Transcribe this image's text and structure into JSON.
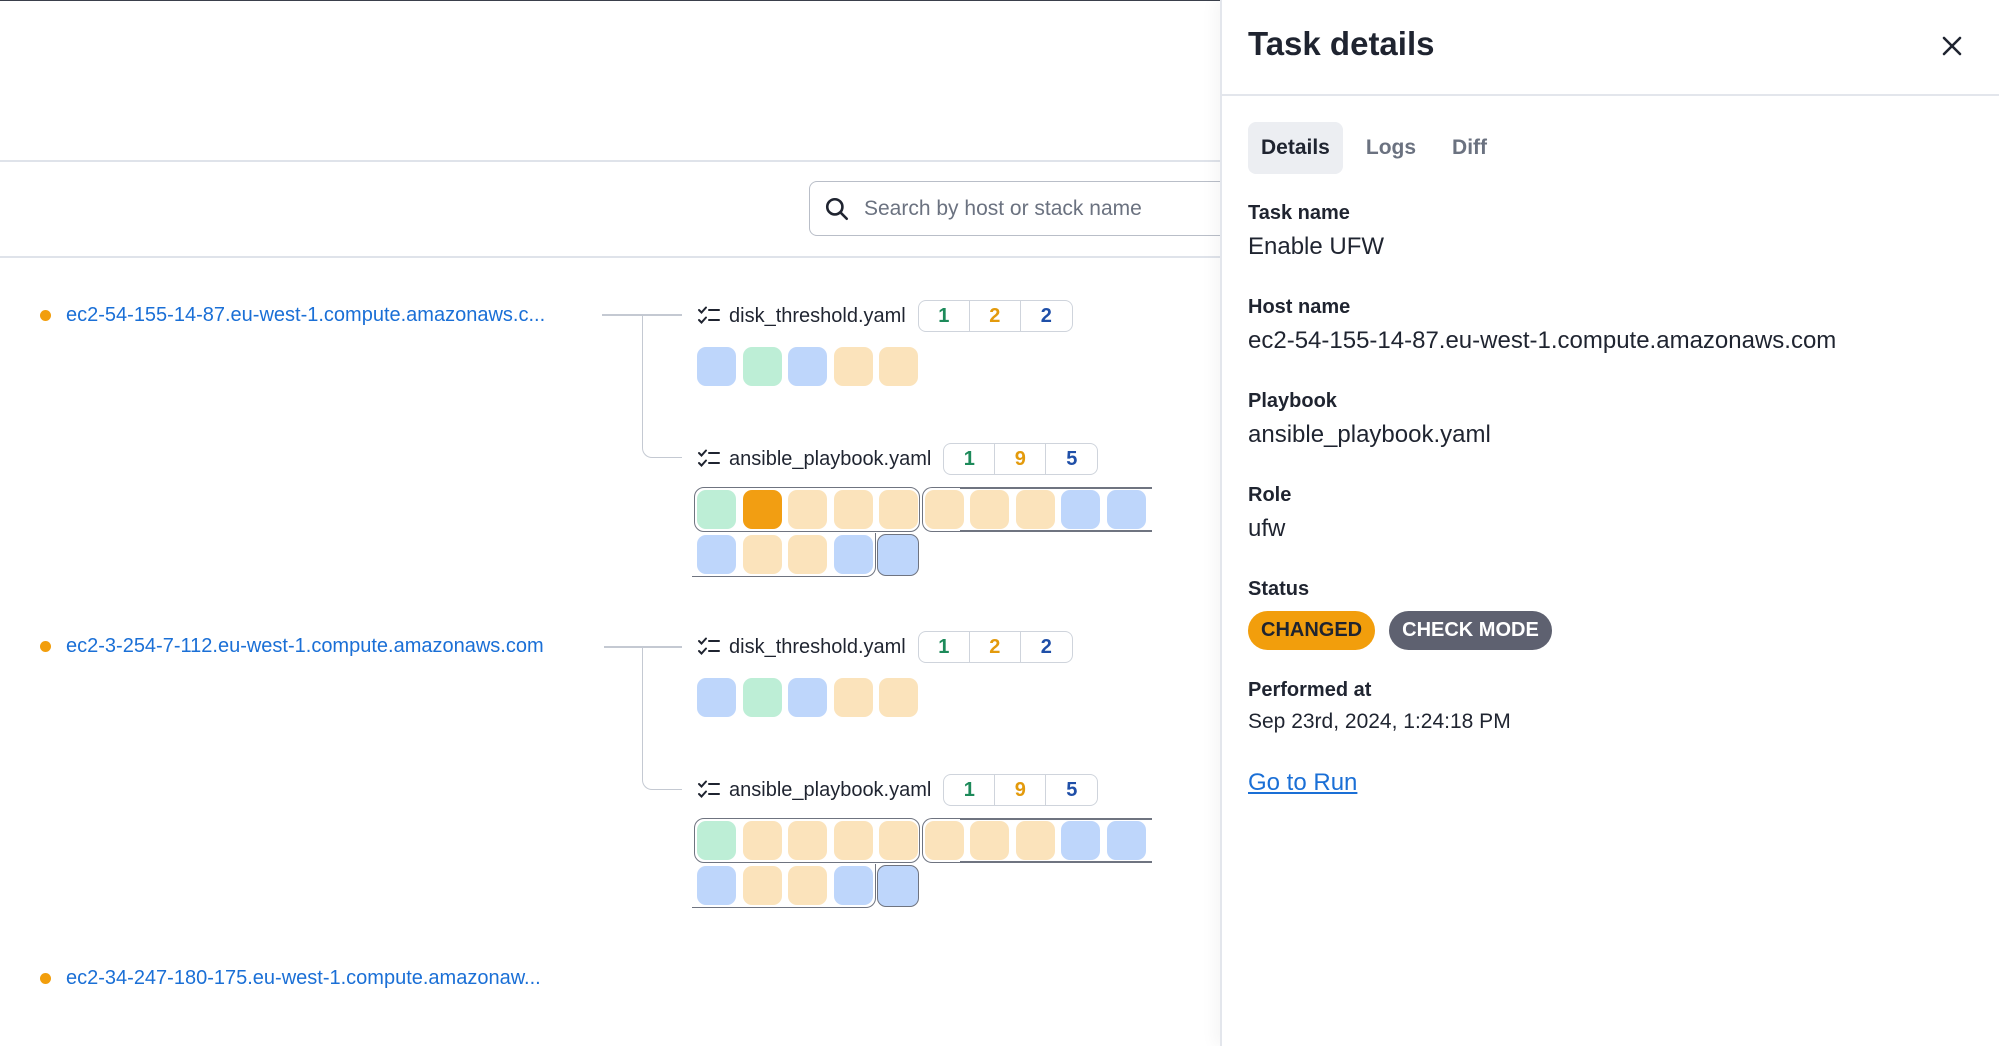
{
  "search": {
    "placeholder": "Search by host or stack name"
  },
  "hosts": [
    {
      "name": "ec2-54-155-14-87.eu-west-1.compute.amazonaws.c...",
      "playbooks": [
        {
          "name": "disk_threshold.yaml",
          "ok": "1",
          "changed": "2",
          "skipped": "2"
        },
        {
          "name": "ansible_playbook.yaml",
          "ok": "1",
          "changed": "9",
          "skipped": "5"
        }
      ]
    },
    {
      "name": "ec2-3-254-7-112.eu-west-1.compute.amazonaws.com",
      "playbooks": [
        {
          "name": "disk_threshold.yaml",
          "ok": "1",
          "changed": "2",
          "skipped": "2"
        },
        {
          "name": "ansible_playbook.yaml",
          "ok": "1",
          "changed": "9",
          "skipped": "5"
        }
      ]
    },
    {
      "name": "ec2-34-247-180-175.eu-west-1.compute.amazonaw...",
      "playbooks": []
    }
  ],
  "panel": {
    "title": "Task details",
    "tabs": [
      "Details",
      "Logs",
      "Diff"
    ],
    "active_tab": "Details",
    "fields": {
      "task_name": {
        "label": "Task name",
        "value": "Enable UFW"
      },
      "host_name": {
        "label": "Host name",
        "value": "ec2-54-155-14-87.eu-west-1.compute.amazonaws.com"
      },
      "playbook": {
        "label": "Playbook",
        "value": "ansible_playbook.yaml"
      },
      "role": {
        "label": "Role",
        "value": "ufw"
      },
      "status": {
        "label": "Status",
        "badges": [
          "CHANGED",
          "CHECK MODE"
        ]
      },
      "performed_at": {
        "label": "Performed at",
        "value": "Sep 23rd, 2024, 1:24:18 PM"
      }
    },
    "go_to_run": "Go to Run"
  },
  "colors": {
    "ok": "#bdeed6",
    "changed": "#fbe3bb",
    "changed_selected": "#f29e12",
    "skipped": "#bed6fb",
    "link": "#1a6fd6",
    "host_dot": "#f29e0c"
  },
  "icons": [
    "search-icon",
    "checklist-icon",
    "close-icon"
  ]
}
